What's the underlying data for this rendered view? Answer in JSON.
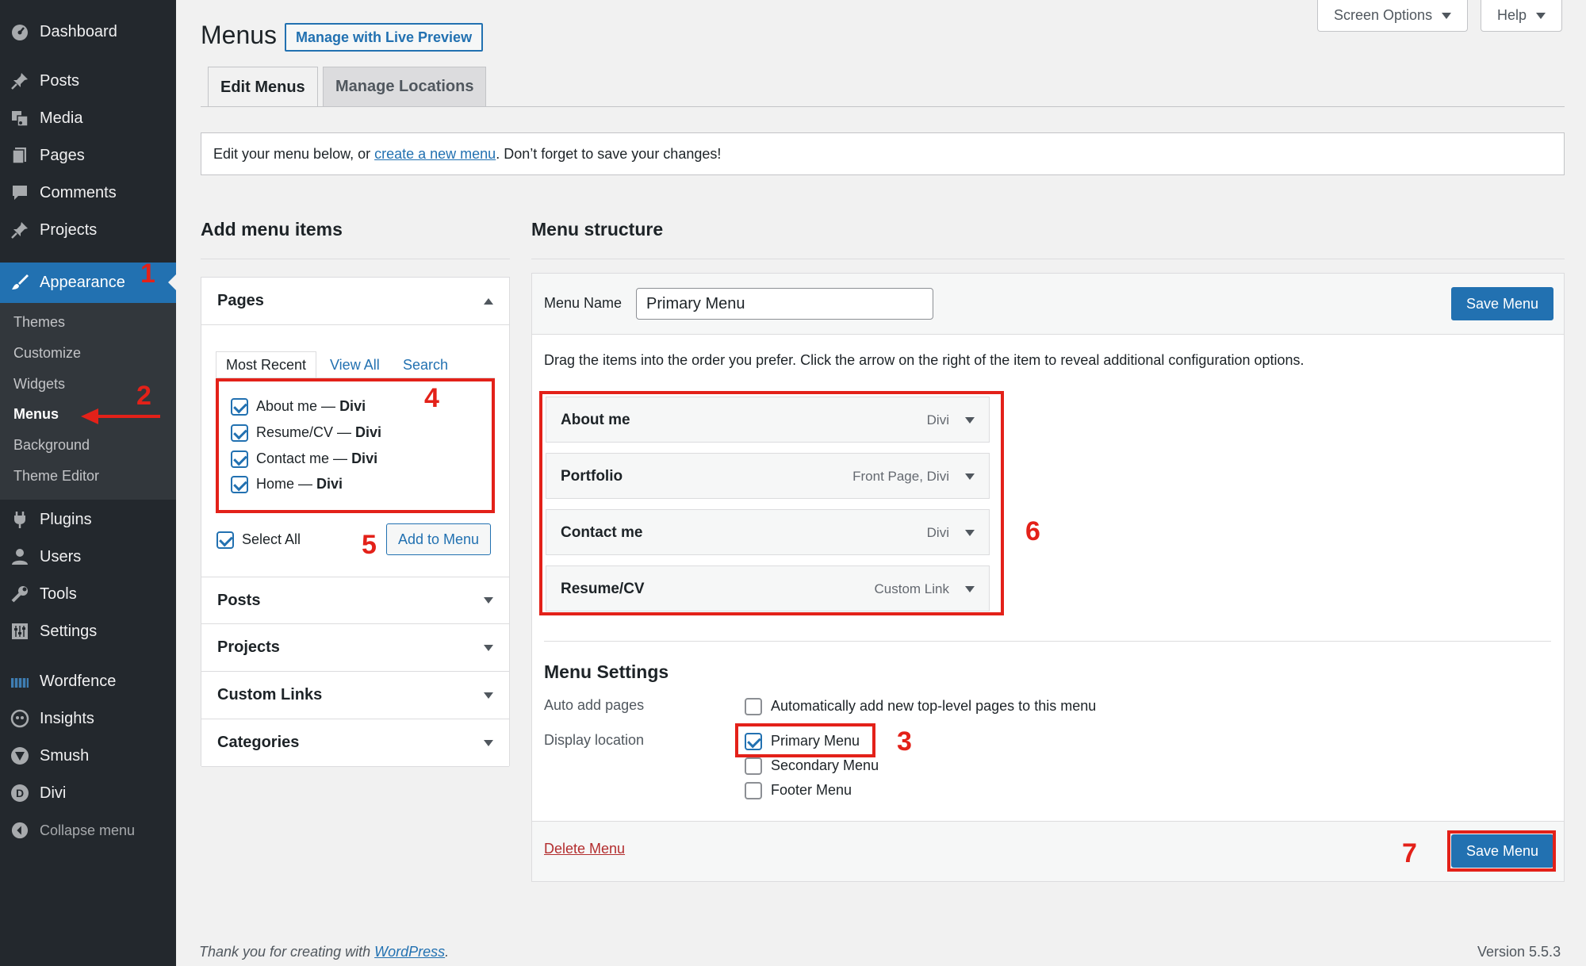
{
  "sidebar": {
    "items": [
      {
        "label": "Dashboard",
        "icon": "dashboard-icon"
      },
      {
        "label": "Posts",
        "icon": "pin-icon"
      },
      {
        "label": "Media",
        "icon": "media-icon"
      },
      {
        "label": "Pages",
        "icon": "pages-icon"
      },
      {
        "label": "Comments",
        "icon": "comment-icon"
      },
      {
        "label": "Projects",
        "icon": "pin-icon"
      },
      {
        "label": "Appearance",
        "icon": "brush-icon"
      },
      {
        "label": "Plugins",
        "icon": "plugin-icon"
      },
      {
        "label": "Users",
        "icon": "user-icon"
      },
      {
        "label": "Tools",
        "icon": "wrench-icon"
      },
      {
        "label": "Settings",
        "icon": "settings-icon"
      },
      {
        "label": "Wordfence",
        "icon": "wordfence-icon"
      },
      {
        "label": "Insights",
        "icon": "insights-icon"
      },
      {
        "label": "Smush",
        "icon": "smush-icon"
      },
      {
        "label": "Divi",
        "icon": "divi-icon"
      }
    ],
    "submenu": [
      "Themes",
      "Customize",
      "Widgets",
      "Menus",
      "Background",
      "Theme Editor"
    ],
    "collapse_label": "Collapse menu"
  },
  "top_buttons": {
    "screen_options": "Screen Options",
    "help": "Help"
  },
  "header": {
    "title": "Menus",
    "live_preview": "Manage with Live Preview"
  },
  "tabs": [
    "Edit Menus",
    "Manage Locations"
  ],
  "notice": {
    "before": "Edit your menu below, or",
    "link": "create a new menu",
    "after": ". Don’t forget to save your changes!"
  },
  "add_items": {
    "heading": "Add menu items",
    "pages": {
      "title": "Pages",
      "tabs": [
        "Most Recent",
        "View All",
        "Search"
      ],
      "items": [
        {
          "name": "About me",
          "sep": " — ",
          "theme": "Divi",
          "checked": true
        },
        {
          "name": "Resume/CV",
          "sep": " — ",
          "theme": "Divi",
          "checked": true
        },
        {
          "name": "Contact me",
          "sep": " — ",
          "theme": "Divi",
          "checked": true
        },
        {
          "name": "Home",
          "sep": " — ",
          "theme": "Divi",
          "checked": true
        }
      ],
      "select_all": "Select All",
      "add_button": "Add to Menu"
    },
    "sections": [
      "Posts",
      "Projects",
      "Custom Links",
      "Categories"
    ]
  },
  "menu_structure": {
    "heading": "Menu structure",
    "menu_name_label": "Menu Name",
    "menu_name_value": "Primary Menu",
    "save_label": "Save Menu",
    "instructions": "Drag the items into the order you prefer. Click the arrow on the right of the item to reveal additional configuration options.",
    "items": [
      {
        "title": "About me",
        "type": "Divi"
      },
      {
        "title": "Portfolio",
        "type": "Front Page, Divi"
      },
      {
        "title": "Contact me",
        "type": "Divi"
      },
      {
        "title": "Resume/CV",
        "type": "Custom Link"
      }
    ],
    "settings": {
      "heading": "Menu Settings",
      "auto_add_label": "Auto add pages",
      "auto_add_option": "Automatically add new top-level pages to this menu",
      "auto_add_checked": false,
      "display_location_label": "Display location",
      "locations": [
        {
          "name": "Primary Menu",
          "checked": true
        },
        {
          "name": "Secondary Menu",
          "checked": false
        },
        {
          "name": "Footer Menu",
          "checked": false
        }
      ]
    },
    "delete_label": "Delete Menu"
  },
  "annotations": [
    "1",
    "2",
    "3",
    "4",
    "5",
    "6",
    "7"
  ],
  "footer": {
    "thanks_before": "Thank you for creating with ",
    "thanks_link": "WordPress",
    "thanks_after": ".",
    "version": "Version 5.5.3"
  },
  "colors": {
    "accent": "#2271b1",
    "sidebar": "#23282d",
    "annotation": "#e32119"
  }
}
